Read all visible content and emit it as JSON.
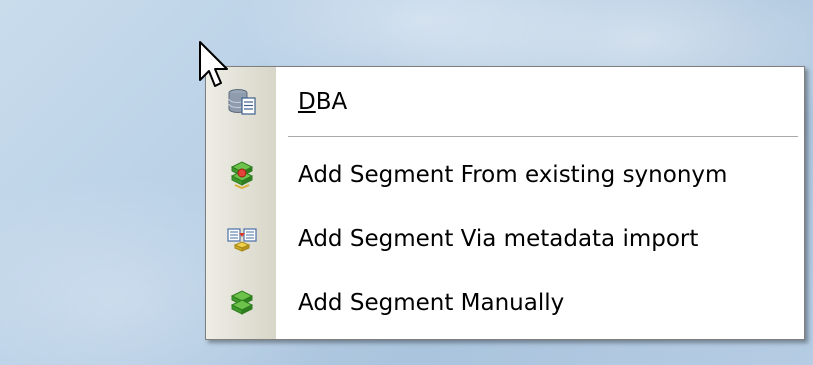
{
  "context_menu": {
    "items": [
      {
        "label_mnemonic": "D",
        "label_rest": "BA",
        "icon": "database-document-icon"
      },
      {
        "label": "Add Segment From existing synonym",
        "icon": "segment-synonym-icon"
      },
      {
        "label": "Add Segment Via metadata import",
        "icon": "metadata-import-icon"
      },
      {
        "label": "Add Segment Manually",
        "icon": "segment-manual-icon"
      }
    ]
  },
  "colors": {
    "menu_background": "#ffffff",
    "icon_strip": "#e2e0d4",
    "separator": "#a9a9a9",
    "desktop": "#b9d0e6"
  }
}
